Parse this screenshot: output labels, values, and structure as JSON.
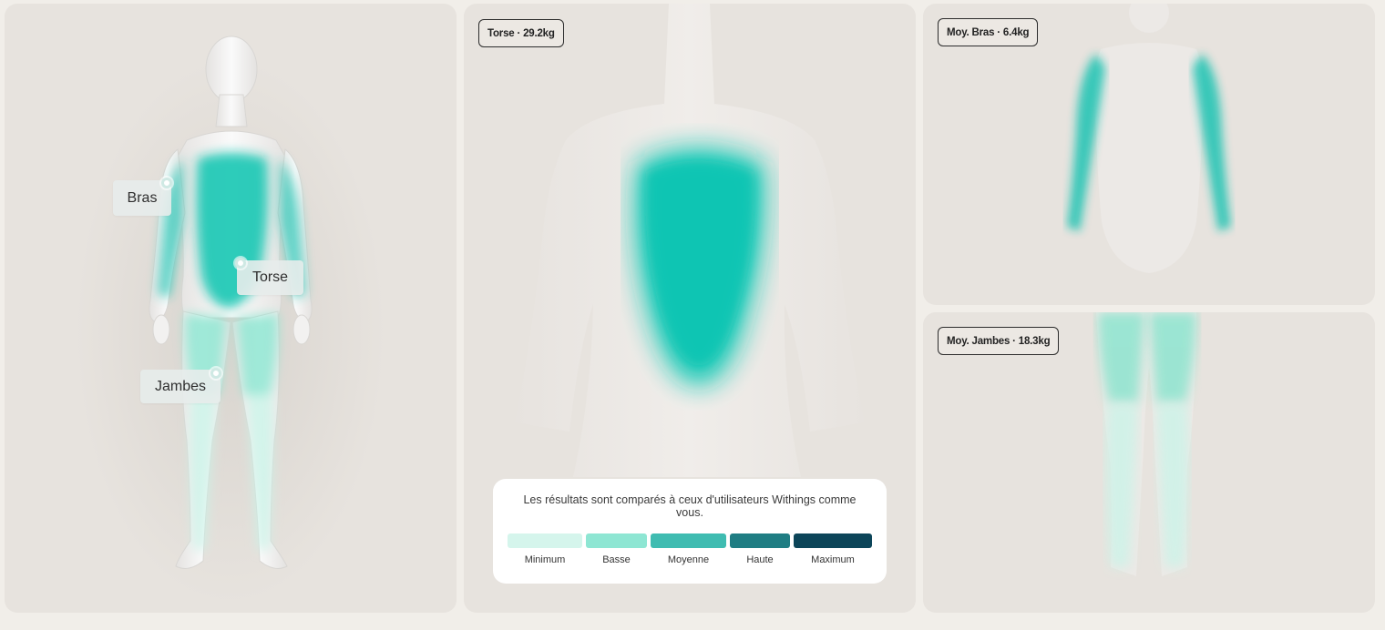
{
  "main_panel": {
    "labels": [
      {
        "id": "arms",
        "text": "Bras"
      },
      {
        "id": "torso",
        "text": "Torse"
      },
      {
        "id": "legs",
        "text": "Jambes"
      }
    ]
  },
  "torso_panel": {
    "chip": "Torse · 29.2kg",
    "level": "Moyenne"
  },
  "arms_panel": {
    "chip": "Moy. Bras · 6.4kg",
    "level": "Moyenne"
  },
  "legs_panel": {
    "chip": "Moy. Jambes · 18.3kg",
    "level": "Basse"
  },
  "legend": {
    "description": "Les résultats sont comparés à ceux d'utilisateurs Withings comme vous.",
    "levels": [
      {
        "label": "Minimum",
        "color": "#d5f5ec"
      },
      {
        "label": "Basse",
        "color": "#8ee6d3"
      },
      {
        "label": "Moyenne",
        "color": "#3fbcb1"
      },
      {
        "label": "Haute",
        "color": "#1f7d83"
      },
      {
        "label": "Maximum",
        "color": "#0c4559"
      }
    ]
  },
  "colors": {
    "background": "#f1eee9",
    "panel": "#e7e3de",
    "accent_teal": "#17cbb8"
  }
}
